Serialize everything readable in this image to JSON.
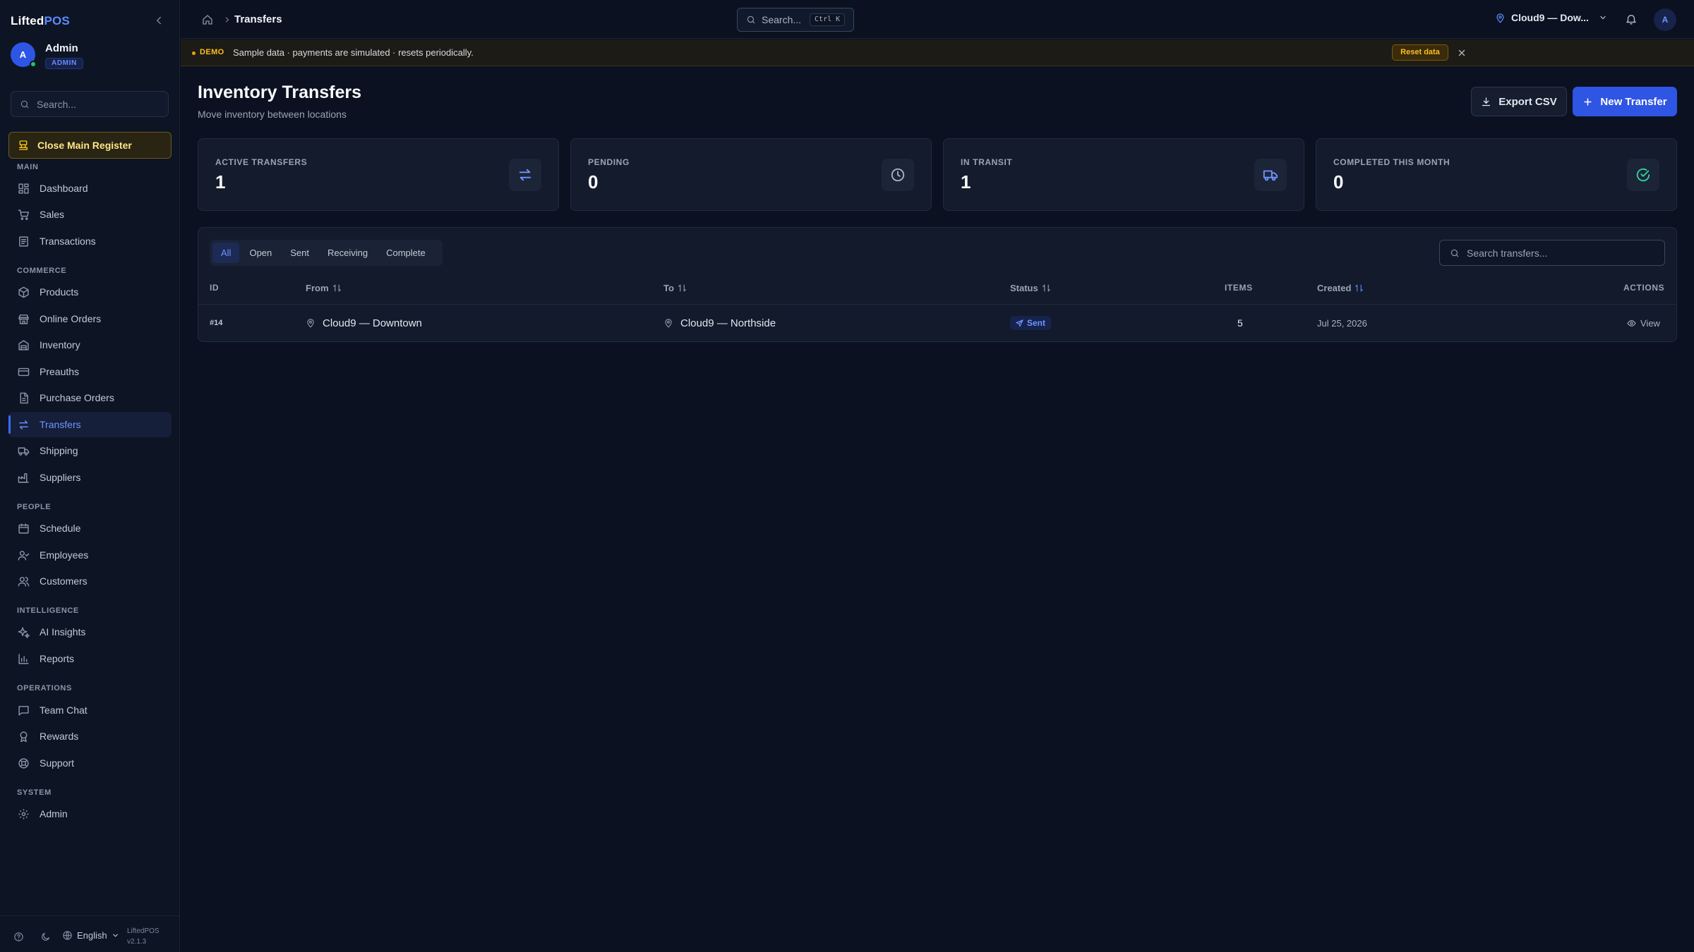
{
  "app": {
    "brand_part1": "Lifted",
    "brand_part2": "POS",
    "version_name": "LiftedPOS",
    "version": "v2.1.3"
  },
  "user": {
    "initial": "A",
    "name": "Admin",
    "role": "ADMIN"
  },
  "sidebar": {
    "search_placeholder": "Search...",
    "register_button": "Close Main Register",
    "sections": {
      "main": "MAIN",
      "commerce": "COMMERCE",
      "people": "PEOPLE",
      "intelligence": "INTELLIGENCE",
      "operations": "OPERATIONS",
      "system": "SYSTEM"
    },
    "items": {
      "dashboard": "Dashboard",
      "sales": "Sales",
      "transactions": "Transactions",
      "products": "Products",
      "online_orders": "Online Orders",
      "inventory": "Inventory",
      "preauths": "Preauths",
      "purchase_orders": "Purchase Orders",
      "transfers": "Transfers",
      "shipping": "Shipping",
      "suppliers": "Suppliers",
      "schedule": "Schedule",
      "employees": "Employees",
      "customers": "Customers",
      "ai_insights": "AI Insights",
      "reports": "Reports",
      "team_chat": "Team Chat",
      "rewards": "Rewards",
      "support": "Support",
      "admin": "Admin"
    },
    "active_item": "transfers",
    "footer": {
      "language": "English"
    }
  },
  "topbar": {
    "breadcrumb_current": "Transfers",
    "search_placeholder": "Search...",
    "search_shortcut": "Ctrl K",
    "location": "Cloud9 — Dow...",
    "avatar_initial": "A"
  },
  "banner": {
    "tag": "DEMO",
    "text": "Sample data · payments are simulated · resets periodically.",
    "reset_button": "Reset data"
  },
  "page": {
    "title": "Inventory Transfers",
    "subtitle": "Move inventory between locations",
    "export_button": "Export CSV",
    "new_button": "New Transfer"
  },
  "stats": [
    {
      "label": "ACTIVE TRANSFERS",
      "value": "1",
      "icon": "arrows-exchange-icon",
      "color": "#6f94ff"
    },
    {
      "label": "PENDING",
      "value": "0",
      "icon": "clock-icon",
      "color": "#aab3c2"
    },
    {
      "label": "IN TRANSIT",
      "value": "1",
      "icon": "truck-icon",
      "color": "#6f94ff"
    },
    {
      "label": "COMPLETED THIS MONTH",
      "value": "0",
      "icon": "check-circle-icon",
      "color": "#34d399"
    }
  ],
  "table": {
    "tabs": [
      "All",
      "Open",
      "Sent",
      "Receiving",
      "Complete"
    ],
    "active_tab": "All",
    "search_placeholder": "Search transfers...",
    "columns": {
      "id": "ID",
      "from": "From",
      "to": "To",
      "status": "Status",
      "items": "ITEMS",
      "created": "Created",
      "actions": "ACTIONS"
    },
    "rows": [
      {
        "id": "#14",
        "from": "Cloud9 — Downtown",
        "to": "Cloud9 — Northside",
        "status": "Sent",
        "items": "5",
        "created": "Jul 25, 2026",
        "action": "View"
      }
    ]
  },
  "colors": {
    "accent": "#2f55e4",
    "accent_text": "#6f94ff",
    "background": "#0b1120",
    "demo": "#fbbf24",
    "success": "#34d399"
  }
}
